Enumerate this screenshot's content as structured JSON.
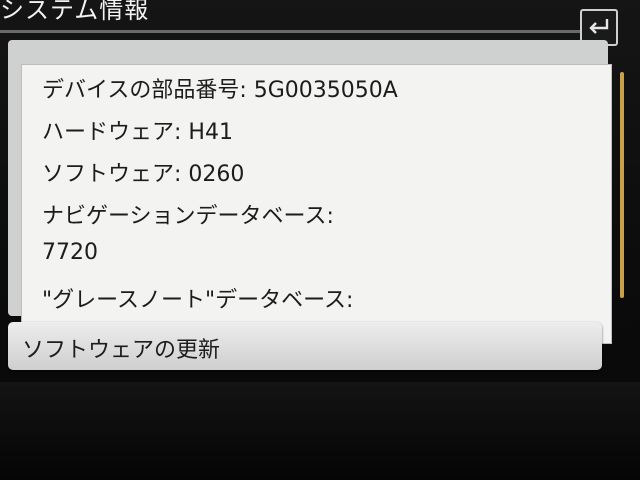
{
  "header": {
    "title": "システム情報",
    "back_icon": "return-arrow-icon"
  },
  "info": {
    "items": [
      {
        "label": "デバイスの部品番号:",
        "value": "5G0035050A"
      },
      {
        "label": "ハードウェア:",
        "value": "H41"
      },
      {
        "label": "ソフトウェア:",
        "value": "0260"
      },
      {
        "label": "ナビゲーションデータベース:",
        "value": ""
      },
      {
        "label": "",
        "value": "7720"
      },
      {
        "label": "\"グレースノート\"データベース:",
        "value": ""
      }
    ]
  },
  "actions": {
    "update_label": "ソフトウェアの更新"
  },
  "colors": {
    "scrollbar_accent": "#caa14a",
    "list_background": "#f3f3f2",
    "screen_background": "#0b0b0b"
  }
}
